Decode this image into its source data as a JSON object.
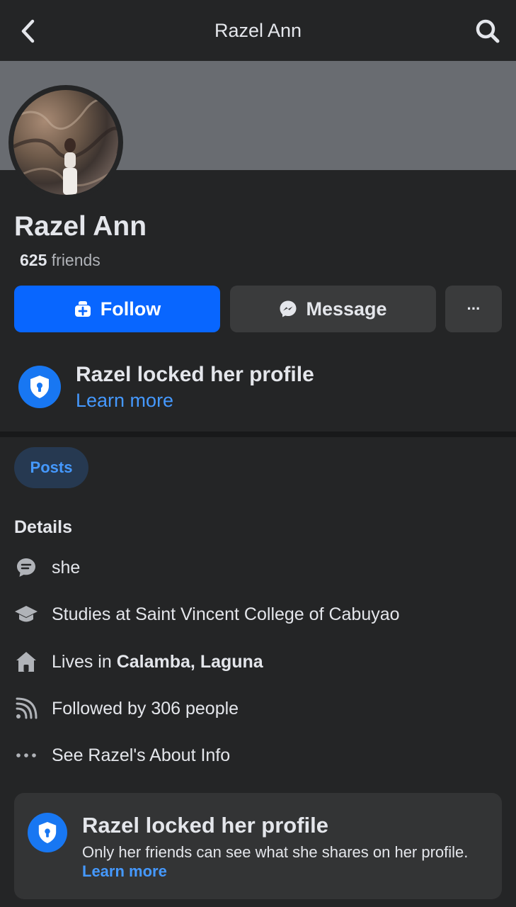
{
  "header": {
    "title": "Razel Ann",
    "back_icon": "chevron-left-icon",
    "search_icon": "search-icon"
  },
  "profile": {
    "name": "Razel Ann",
    "friends_count": "625",
    "friends_label": "friends"
  },
  "actions": {
    "follow_label": "Follow",
    "follow_icon": "add-friend-icon",
    "message_label": "Message",
    "message_icon": "messenger-icon",
    "more_label": "···"
  },
  "lock_notice": {
    "title": "Razel locked her profile",
    "learn_more": "Learn more",
    "icon": "shield-lock-icon"
  },
  "tabs": {
    "posts_label": "Posts"
  },
  "details": {
    "title": "Details",
    "items": [
      {
        "icon": "chat-bubble-icon",
        "text": "she"
      },
      {
        "icon": "graduation-cap-icon",
        "text": "Studies at Saint Vincent College of Cabuyao"
      },
      {
        "icon": "home-icon",
        "prefix": "Lives in ",
        "bold": "Calamba, Laguna"
      },
      {
        "icon": "rss-icon",
        "text": "Followed by 306 people"
      },
      {
        "icon": "ellipsis-icon",
        "text": "See Razel's About Info"
      }
    ]
  },
  "info_card": {
    "title": "Razel locked her profile",
    "body": "Only her friends can see what she shares on her profile.",
    "learn_more": "Learn more",
    "icon": "shield-lock-icon"
  },
  "colors": {
    "background": "#242526",
    "cover": "#696c71",
    "accent": "#0866ff",
    "link": "#4599ff",
    "button_secondary": "#3a3b3c",
    "card": "#333435"
  }
}
